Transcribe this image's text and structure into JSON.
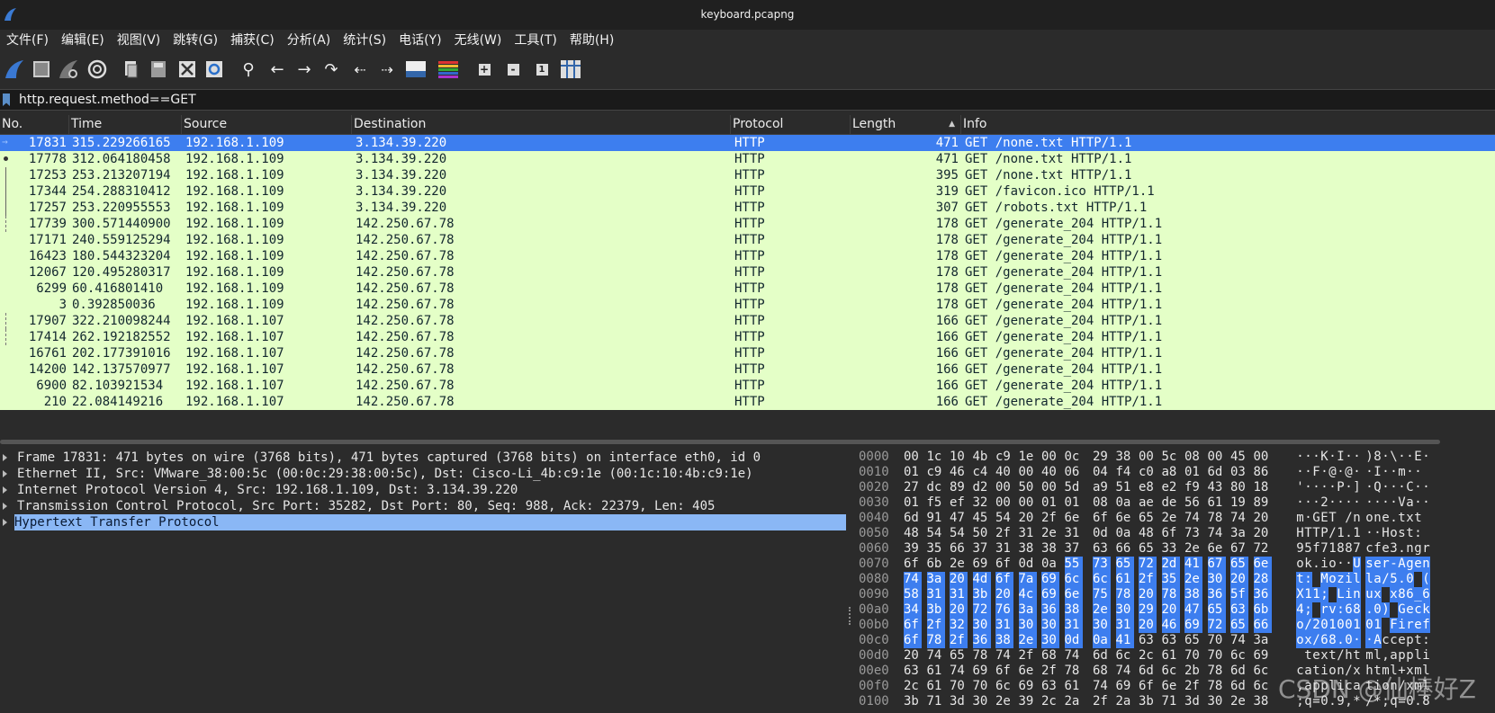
{
  "window": {
    "title": "keyboard.pcapng"
  },
  "menu": [
    "文件(F)",
    "编辑(E)",
    "视图(V)",
    "跳转(G)",
    "捕获(C)",
    "分析(A)",
    "统计(S)",
    "电话(Y)",
    "无线(W)",
    "工具(T)",
    "帮助(H)"
  ],
  "toolbar": {
    "icons": [
      "shark-fin-start-icon",
      "stop-square-icon",
      "restart-fin-icon",
      "options-gear-icon",
      "open-file-icon",
      "save-file-icon",
      "close-file-icon",
      "reload-file-icon",
      "find-magnifier-icon",
      "go-back-arrow-icon",
      "go-forward-arrow-icon",
      "go-to-packet-icon",
      "first-packet-icon",
      "last-packet-icon",
      "autoscroll-icon",
      "colorize-icon",
      "zoom-in-icon",
      "zoom-out-icon",
      "normal-size-icon",
      "resize-columns-icon"
    ]
  },
  "filter": {
    "value": "http.request.method==GET"
  },
  "columns": [
    "No.",
    "Time",
    "Source",
    "Destination",
    "Protocol",
    "Length",
    "Info"
  ],
  "packets": [
    {
      "no": "17831",
      "time": "315.229266165",
      "src": "192.168.1.109",
      "dst": "3.134.39.220",
      "proto": "HTTP",
      "len": "471",
      "info": "GET /none.txt HTTP/1.1"
    },
    {
      "no": "17778",
      "time": "312.064180458",
      "src": "192.168.1.109",
      "dst": "3.134.39.220",
      "proto": "HTTP",
      "len": "471",
      "info": "GET /none.txt HTTP/1.1"
    },
    {
      "no": "17253",
      "time": "253.213207194",
      "src": "192.168.1.109",
      "dst": "3.134.39.220",
      "proto": "HTTP",
      "len": "395",
      "info": "GET /none.txt HTTP/1.1"
    },
    {
      "no": "17344",
      "time": "254.288310412",
      "src": "192.168.1.109",
      "dst": "3.134.39.220",
      "proto": "HTTP",
      "len": "319",
      "info": "GET /favicon.ico HTTP/1.1"
    },
    {
      "no": "17257",
      "time": "253.220955553",
      "src": "192.168.1.109",
      "dst": "3.134.39.220",
      "proto": "HTTP",
      "len": "307",
      "info": "GET /robots.txt HTTP/1.1"
    },
    {
      "no": "17739",
      "time": "300.571440900",
      "src": "192.168.1.109",
      "dst": "142.250.67.78",
      "proto": "HTTP",
      "len": "178",
      "info": "GET /generate_204 HTTP/1.1"
    },
    {
      "no": "17171",
      "time": "240.559125294",
      "src": "192.168.1.109",
      "dst": "142.250.67.78",
      "proto": "HTTP",
      "len": "178",
      "info": "GET /generate_204 HTTP/1.1"
    },
    {
      "no": "16423",
      "time": "180.544323204",
      "src": "192.168.1.109",
      "dst": "142.250.67.78",
      "proto": "HTTP",
      "len": "178",
      "info": "GET /generate_204 HTTP/1.1"
    },
    {
      "no": "12067",
      "time": "120.495280317",
      "src": "192.168.1.109",
      "dst": "142.250.67.78",
      "proto": "HTTP",
      "len": "178",
      "info": "GET /generate_204 HTTP/1.1"
    },
    {
      "no": "6299",
      "time": "60.416801410",
      "src": "192.168.1.109",
      "dst": "142.250.67.78",
      "proto": "HTTP",
      "len": "178",
      "info": "GET /generate_204 HTTP/1.1"
    },
    {
      "no": "3",
      "time": "0.392850036",
      "src": "192.168.1.109",
      "dst": "142.250.67.78",
      "proto": "HTTP",
      "len": "178",
      "info": "GET /generate_204 HTTP/1.1"
    },
    {
      "no": "17907",
      "time": "322.210098244",
      "src": "192.168.1.107",
      "dst": "142.250.67.78",
      "proto": "HTTP",
      "len": "166",
      "info": "GET /generate_204 HTTP/1.1"
    },
    {
      "no": "17414",
      "time": "262.192182552",
      "src": "192.168.1.107",
      "dst": "142.250.67.78",
      "proto": "HTTP",
      "len": "166",
      "info": "GET /generate_204 HTTP/1.1"
    },
    {
      "no": "16761",
      "time": "202.177391016",
      "src": "192.168.1.107",
      "dst": "142.250.67.78",
      "proto": "HTTP",
      "len": "166",
      "info": "GET /generate_204 HTTP/1.1"
    },
    {
      "no": "14200",
      "time": "142.137570977",
      "src": "192.168.1.107",
      "dst": "142.250.67.78",
      "proto": "HTTP",
      "len": "166",
      "info": "GET /generate_204 HTTP/1.1"
    },
    {
      "no": "6900",
      "time": "82.103921534",
      "src": "192.168.1.107",
      "dst": "142.250.67.78",
      "proto": "HTTP",
      "len": "166",
      "info": "GET /generate_204 HTTP/1.1"
    },
    {
      "no": "210",
      "time": "22.084149216",
      "src": "192.168.1.107",
      "dst": "142.250.67.78",
      "proto": "HTTP",
      "len": "166",
      "info": "GET /generate_204 HTTP/1.1"
    }
  ],
  "details": [
    "Frame 17831: 471 bytes on wire (3768 bits), 471 bytes captured (3768 bits) on interface eth0, id 0",
    "Ethernet II, Src: VMware_38:00:5c (00:0c:29:38:00:5c), Dst: Cisco-Li_4b:c9:1e (00:1c:10:4b:c9:1e)",
    "Internet Protocol Version 4, Src: 192.168.1.109, Dst: 3.134.39.220",
    "Transmission Control Protocol, Src Port: 35282, Dst Port: 80, Seq: 988, Ack: 22379, Len: 405",
    "Hypertext Transfer Protocol"
  ],
  "hex": [
    {
      "off": "0000",
      "bytes": "00 1c 10 4b c9 1e 00 0c 29 38 00 5c 08 00 45 00",
      "ascii": "···K·I··)8·\\··E·"
    },
    {
      "off": "0010",
      "bytes": "01 c9 46 c4 40 00 40 06 04 f4 c0 a8 01 6d 03 86",
      "ascii": "··F·@·@··I··m··"
    },
    {
      "off": "0020",
      "bytes": "27 dc 89 d2 00 50 00 5d a9 51 e8 e2 f9 43 80 18",
      "ascii": "'····P·]·Q···C··"
    },
    {
      "off": "0030",
      "bytes": "01 f5 ef 32 00 00 01 01 08 0a ae de 56 61 19 89",
      "ascii": "···2········Va··"
    },
    {
      "off": "0040",
      "bytes": "6d 91 47 45 54 20 2f 6e 6f 6e 65 2e 74 78 74 20",
      "ascii": "m·GET /none.txt "
    },
    {
      "off": "0050",
      "bytes": "48 54 54 50 2f 31 2e 31 0d 0a 48 6f 73 74 3a 20",
      "ascii": "HTTP/1.1··Host: "
    },
    {
      "off": "0060",
      "bytes": "39 35 66 37 31 38 38 37 63 66 65 33 2e 6e 67 72",
      "ascii": "95f71887cfe3.ngr"
    },
    {
      "off": "0070",
      "bytes": "6f 6b 2e 69 6f 0d 0a 55 73 65 72 2d 41 67 65 6e",
      "ascii": "ok.io··User-Agen"
    },
    {
      "off": "0080",
      "bytes": "74 3a 20 4d 6f 7a 69 6c 6c 61 2f 35 2e 30 20 28",
      "ascii": "t: Mozilla/5.0 ("
    },
    {
      "off": "0090",
      "bytes": "58 31 31 3b 20 4c 69 6e 75 78 20 78 38 36 5f 36",
      "ascii": "X11; Linux x86_6"
    },
    {
      "off": "00a0",
      "bytes": "34 3b 20 72 76 3a 36 38 2e 30 29 20 47 65 63 6b",
      "ascii": "4; rv:68.0) Geck"
    },
    {
      "off": "00b0",
      "bytes": "6f 2f 32 30 31 30 30 31 30 31 20 46 69 72 65 66",
      "ascii": "o/20100101 Firef"
    },
    {
      "off": "00c0",
      "bytes": "6f 78 2f 36 38 2e 30 0d 0a 41 63 63 65 70 74 3a",
      "ascii": "ox/68.0··Accept:"
    },
    {
      "off": "00d0",
      "bytes": "20 74 65 78 74 2f 68 74 6d 6c 2c 61 70 70 6c 69",
      "ascii": " text/html,appli"
    },
    {
      "off": "00e0",
      "bytes": "63 61 74 69 6f 6e 2f 78 68 74 6d 6c 2b 78 6d 6c",
      "ascii": "cation/xhtml+xml"
    },
    {
      "off": "00f0",
      "bytes": "2c 61 70 70 6c 69 63 61 74 69 6f 6e 2f 78 6d 6c",
      "ascii": ",application/xml"
    },
    {
      "off": "0100",
      "bytes": "3b 71 3d 30 2e 39 2c 2a 2f 2a 3b 71 3d 30 2e 38",
      "ascii": ";q=0.9,*/*;q=0.8"
    }
  ],
  "watermark": "CSDN @仙棒好Z"
}
